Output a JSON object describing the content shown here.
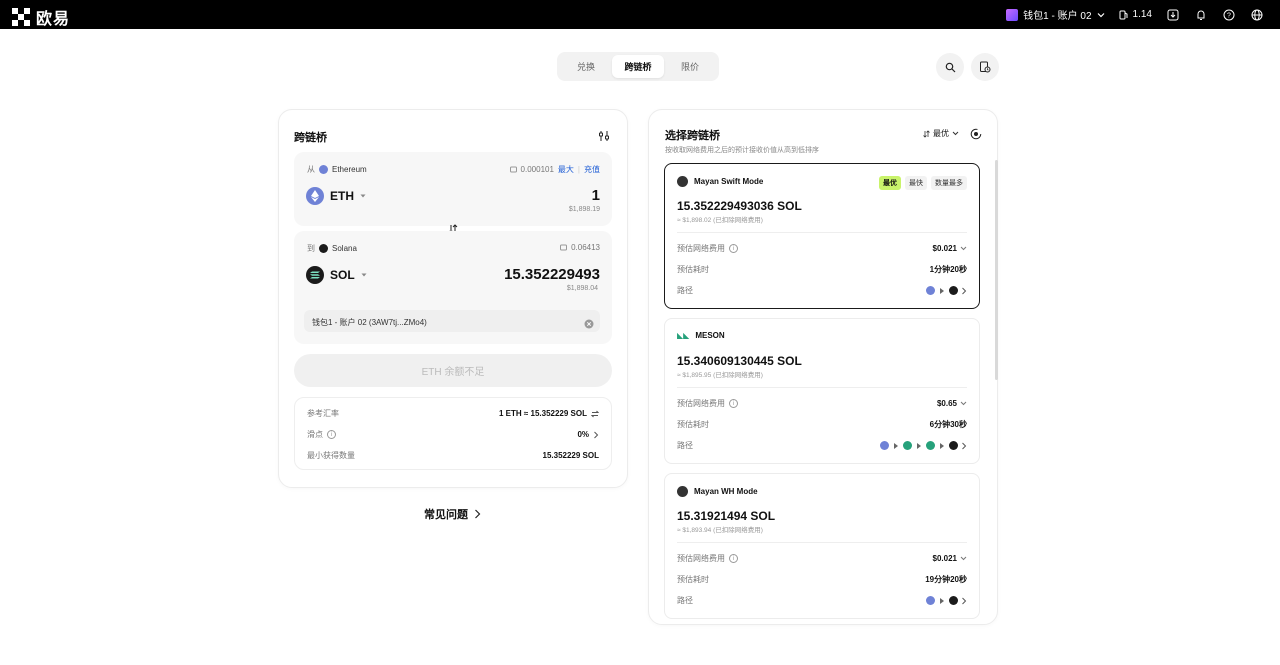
{
  "topbar": {
    "brand": "欧易",
    "wallet_label": "钱包1 - 账户 02",
    "gas_value": "1.14"
  },
  "tabs": [
    {
      "label": "兑换",
      "active": false
    },
    {
      "label": "跨链桥",
      "active": true
    },
    {
      "label": "限价",
      "active": false
    }
  ],
  "bridge": {
    "title": "跨链桥",
    "from": {
      "prefix": "从",
      "network": "Ethereum",
      "balance": "0.000101",
      "max_label": "最大",
      "deposit_label": "充值",
      "token": "ETH",
      "amount": "1",
      "usd": "$1,898.19"
    },
    "to": {
      "prefix": "到",
      "network": "Solana",
      "balance": "0.06413",
      "token": "SOL",
      "amount": "15.352229493",
      "usd": "$1,898.04"
    },
    "receive_address": "钱包1 - 账户 02 (3AW7tj...ZMo4)",
    "submit_label": "ETH 余额不足",
    "info": {
      "rate_label": "参考汇率",
      "rate_value": "1 ETH ≈ 15.352229 SOL",
      "slippage_label": "滑点",
      "slippage_value": "0%",
      "min_label": "最小获得数量",
      "min_value": "15.352229 SOL"
    },
    "faq_label": "常见问题"
  },
  "routes_panel": {
    "title": "选择跨链桥",
    "subtitle": "按收取网络费用之后的预计接收价值从高到低排序",
    "sort_label": "最优",
    "routes": [
      {
        "name": "Mayan Swift Mode",
        "badges": [
          "最优",
          "最快",
          "数量最多"
        ],
        "amount": "15.352229493036 SOL",
        "usd": "≈ $1,898.02 (已扣除网络费用)",
        "fee_label": "预估网络费用",
        "fee": "$0.021",
        "time_label": "预估耗时",
        "time": "1分钟20秒",
        "path_label": "路径"
      },
      {
        "name": "MESON",
        "badges": [],
        "amount": "15.340609130445 SOL",
        "usd": "≈ $1,895.95 (已扣除网络费用)",
        "fee_label": "预估网络费用",
        "fee": "$0.65",
        "time_label": "预估耗时",
        "time": "6分钟30秒",
        "path_label": "路径"
      },
      {
        "name": "Mayan WH Mode",
        "badges": [],
        "amount": "15.31921494 SOL",
        "usd": "≈ $1,893.94 (已扣除网络费用)",
        "fee_label": "预估网络费用",
        "fee": "$0.021",
        "time_label": "预估耗时",
        "time": "19分钟20秒",
        "path_label": "路径"
      }
    ]
  },
  "colors": {
    "best_badge": "#c9f36b",
    "eth": "#6f82d6",
    "sol": "#1b1b1b",
    "usdc": "#2775ca",
    "usdt": "#26a17b"
  }
}
